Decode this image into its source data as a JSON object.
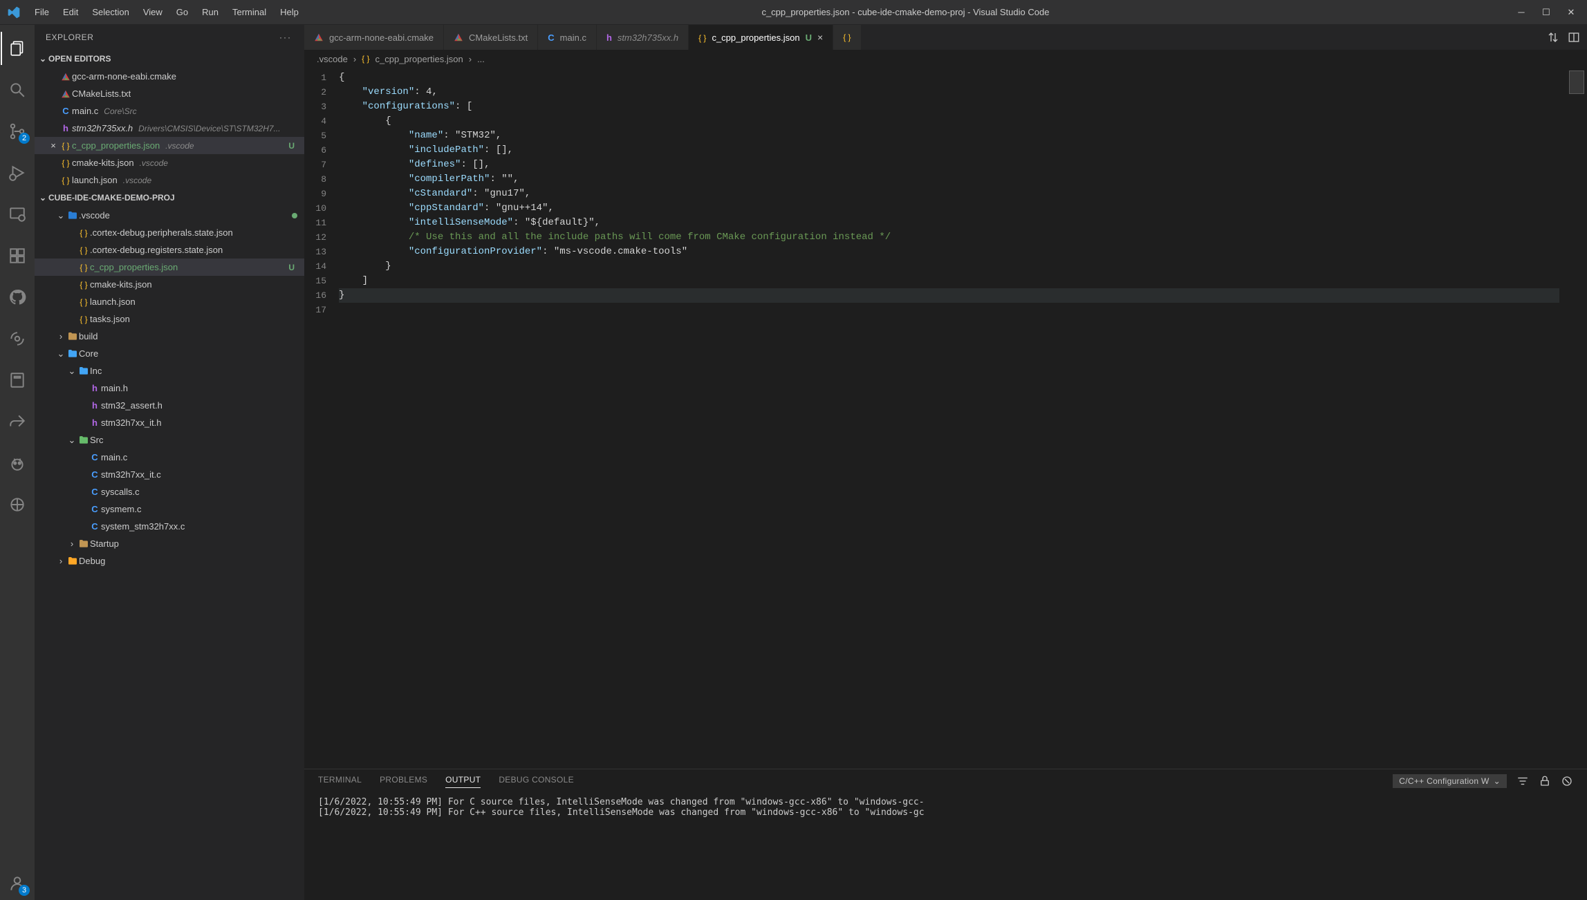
{
  "title": "c_cpp_properties.json - cube-ide-cmake-demo-proj - Visual Studio Code",
  "menu": [
    "File",
    "Edit",
    "Selection",
    "View",
    "Go",
    "Run",
    "Terminal",
    "Help"
  ],
  "activity": {
    "scm_badge": "2",
    "accounts_badge": "3"
  },
  "sidebar": {
    "title": "EXPLORER",
    "open_editors_header": "OPEN EDITORS",
    "project_header": "CUBE-IDE-CMAKE-DEMO-PROJ",
    "open_editors": [
      {
        "icon": "cmake",
        "label": "gcc-arm-none-eabi.cmake",
        "desc": ""
      },
      {
        "icon": "cmake",
        "label": "CMakeLists.txt",
        "desc": ""
      },
      {
        "icon": "c",
        "label": "main.c",
        "desc": "Core\\Src"
      },
      {
        "icon": "h",
        "label": "stm32h735xx.h",
        "desc": "Drivers\\CMSIS\\Device\\ST\\STM32H7...",
        "italic": true
      },
      {
        "icon": "json",
        "label": "c_cpp_properties.json",
        "desc": ".vscode",
        "untracked": true,
        "status": "U",
        "close": true,
        "selected": true
      },
      {
        "icon": "json",
        "label": "cmake-kits.json",
        "desc": ".vscode"
      },
      {
        "icon": "json",
        "label": "launch.json",
        "desc": ".vscode"
      }
    ],
    "tree": [
      {
        "type": "folder",
        "label": ".vscode",
        "expanded": true,
        "folderClass": "icon-folder-vscode",
        "dot": true,
        "indent": 1,
        "children": [
          {
            "type": "file",
            "icon": "json",
            "label": ".cortex-debug.peripherals.state.json"
          },
          {
            "type": "file",
            "icon": "json",
            "label": ".cortex-debug.registers.state.json"
          },
          {
            "type": "file",
            "icon": "json",
            "label": "c_cpp_properties.json",
            "untracked": true,
            "status": "U",
            "selected": true
          },
          {
            "type": "file",
            "icon": "json",
            "label": "cmake-kits.json"
          },
          {
            "type": "file",
            "icon": "json",
            "label": "launch.json"
          },
          {
            "type": "file",
            "icon": "json",
            "label": "tasks.json"
          }
        ]
      },
      {
        "type": "folder",
        "label": "build",
        "expanded": false,
        "folderClass": "icon-folder",
        "indent": 1
      },
      {
        "type": "folder",
        "label": "Core",
        "expanded": true,
        "folderClass": "icon-folder-core",
        "indent": 1,
        "children": [
          {
            "type": "folder",
            "label": "Inc",
            "expanded": true,
            "folderClass": "icon-folder-core",
            "indent": 2,
            "children": [
              {
                "type": "file",
                "icon": "h",
                "label": "main.h"
              },
              {
                "type": "file",
                "icon": "h",
                "label": "stm32_assert.h"
              },
              {
                "type": "file",
                "icon": "h",
                "label": "stm32h7xx_it.h"
              }
            ]
          },
          {
            "type": "folder",
            "label": "Src",
            "expanded": true,
            "folderClass": "icon-folder-src",
            "indent": 2,
            "children": [
              {
                "type": "file",
                "icon": "c",
                "label": "main.c"
              },
              {
                "type": "file",
                "icon": "c",
                "label": "stm32h7xx_it.c"
              },
              {
                "type": "file",
                "icon": "c",
                "label": "syscalls.c"
              },
              {
                "type": "file",
                "icon": "c",
                "label": "sysmem.c"
              },
              {
                "type": "file",
                "icon": "c",
                "label": "system_stm32h7xx.c"
              }
            ]
          },
          {
            "type": "folder",
            "label": "Startup",
            "expanded": false,
            "folderClass": "icon-folder",
            "indent": 2
          }
        ]
      },
      {
        "type": "folder",
        "label": "Debug",
        "expanded": false,
        "folderClass": "icon-folder-debug",
        "indent": 1
      }
    ]
  },
  "tabs": [
    {
      "icon": "cmake",
      "label": "gcc-arm-none-eabi.cmake"
    },
    {
      "icon": "cmake",
      "label": "CMakeLists.txt"
    },
    {
      "icon": "c",
      "label": "main.c"
    },
    {
      "icon": "h",
      "label": "stm32h735xx.h",
      "italic": true
    },
    {
      "icon": "json",
      "label": "c_cpp_properties.json",
      "active": true,
      "status": "U",
      "close": true
    },
    {
      "icon": "json",
      "label": "",
      "ellipsis": true
    }
  ],
  "breadcrumb": {
    "seg1": ".vscode",
    "seg2": "c_cpp_properties.json",
    "seg3": "..."
  },
  "code_lines": [
    "{",
    "    \"version\": 4,",
    "    \"configurations\": [",
    "        {",
    "            \"name\": \"STM32\",",
    "            \"includePath\": [],",
    "            \"defines\": [],",
    "            \"compilerPath\": \"\",",
    "            \"cStandard\": \"gnu17\",",
    "            \"cppStandard\": \"gnu++14\",",
    "            \"intelliSenseMode\": \"${default}\",",
    "",
    "            /* Use this and all the include paths will come from CMake configuration instead */",
    "            \"configurationProvider\": \"ms-vscode.cmake-tools\"",
    "        }",
    "    ]",
    "}"
  ],
  "panel": {
    "tabs": [
      "TERMINAL",
      "PROBLEMS",
      "OUTPUT",
      "DEBUG CONSOLE"
    ],
    "active_tab": "OUTPUT",
    "selector": "C/C++ Configuration W",
    "output": [
      "[1/6/2022, 10:55:49 PM] For C source files, IntelliSenseMode was changed from \"windows-gcc-x86\" to \"windows-gcc-",
      "[1/6/2022, 10:55:49 PM] For C++ source files, IntelliSenseMode was changed from \"windows-gcc-x86\" to \"windows-gc"
    ]
  }
}
